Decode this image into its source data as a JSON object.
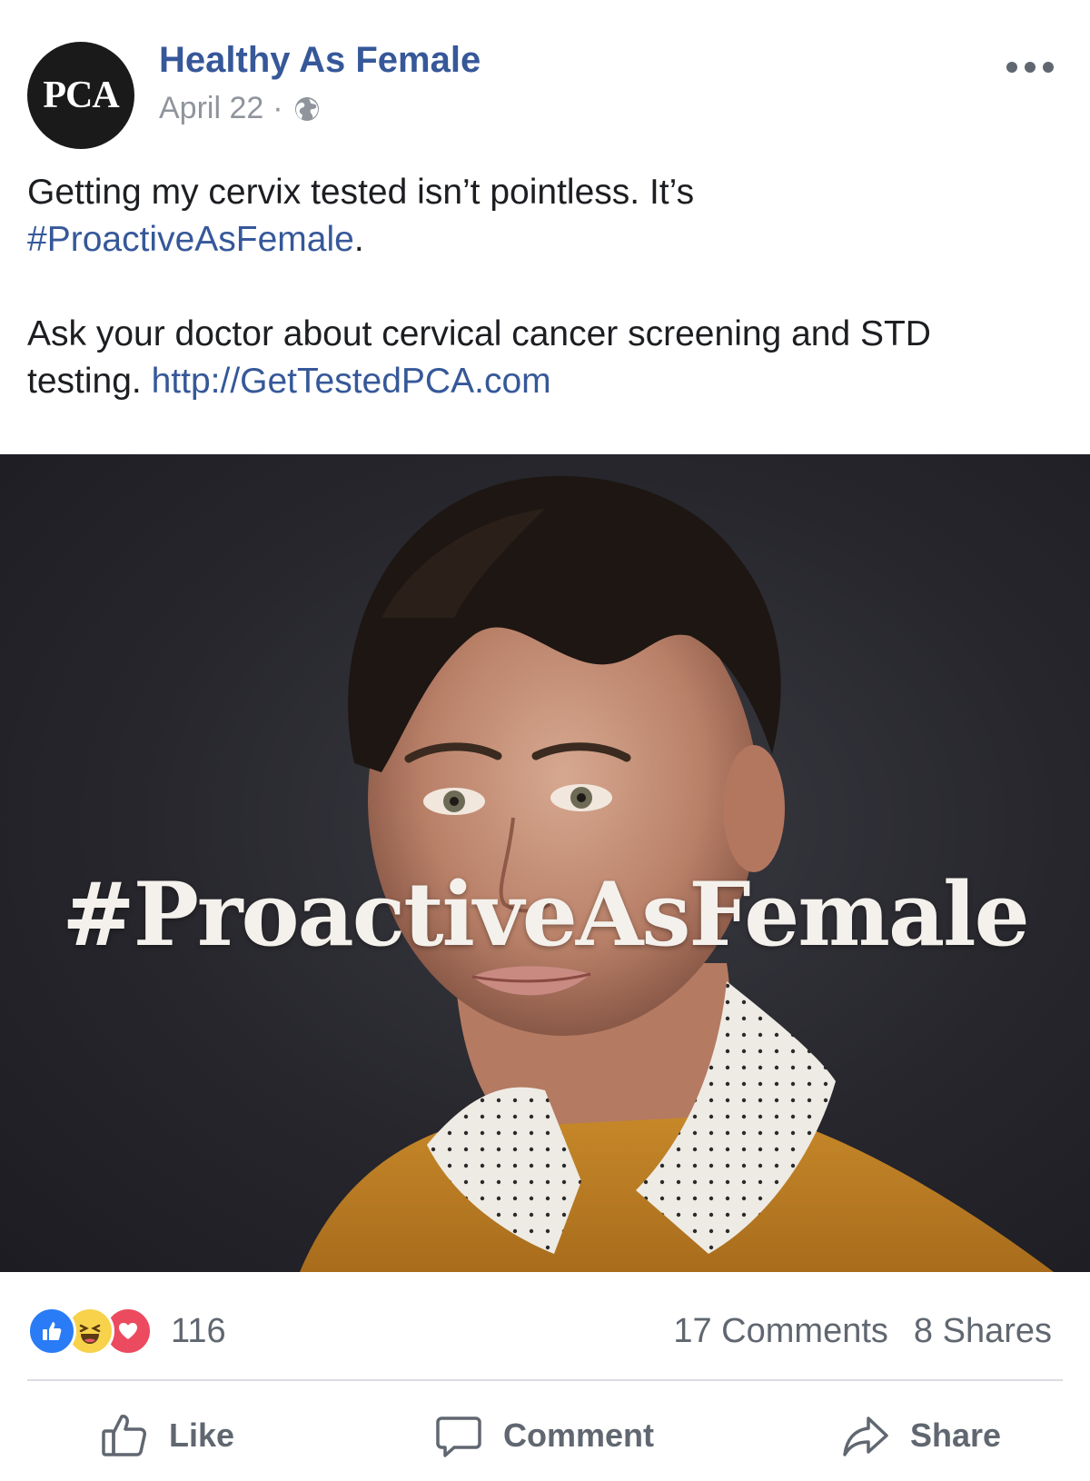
{
  "header": {
    "avatar_text": "PCA",
    "page_name": "Healthy As Female",
    "date": "April 22",
    "separator": "·",
    "privacy_icon": "globe-icon",
    "more_icon": "more-options-icon"
  },
  "post": {
    "line1_text": "Getting my cervix tested isn’t pointless. It’s",
    "hashtag": "#ProactiveAsFemale",
    "hashtag_suffix": ".",
    "line2_text": "Ask your doctor about cervical cancer screening and STD testing.",
    "link": "http://GetTestedPCA.com"
  },
  "image": {
    "overlay_text": "#ProactiveAsFemale"
  },
  "engagement": {
    "reaction_icons": [
      "like-reaction-icon",
      "haha-reaction-icon",
      "love-reaction-icon"
    ],
    "reaction_count": "116",
    "comments": "17 Comments",
    "shares": "8 Shares"
  },
  "actions": {
    "like_label": "Like",
    "comment_label": "Comment",
    "share_label": "Share"
  },
  "colors": {
    "link_blue": "#365899",
    "meta_gray": "#90949c",
    "action_gray": "#606770",
    "like_blue": "#2a7bf6",
    "haha_yellow": "#f7d24a",
    "love_red": "#ec4a5e",
    "avatar_bg": "#1a1a1a"
  }
}
